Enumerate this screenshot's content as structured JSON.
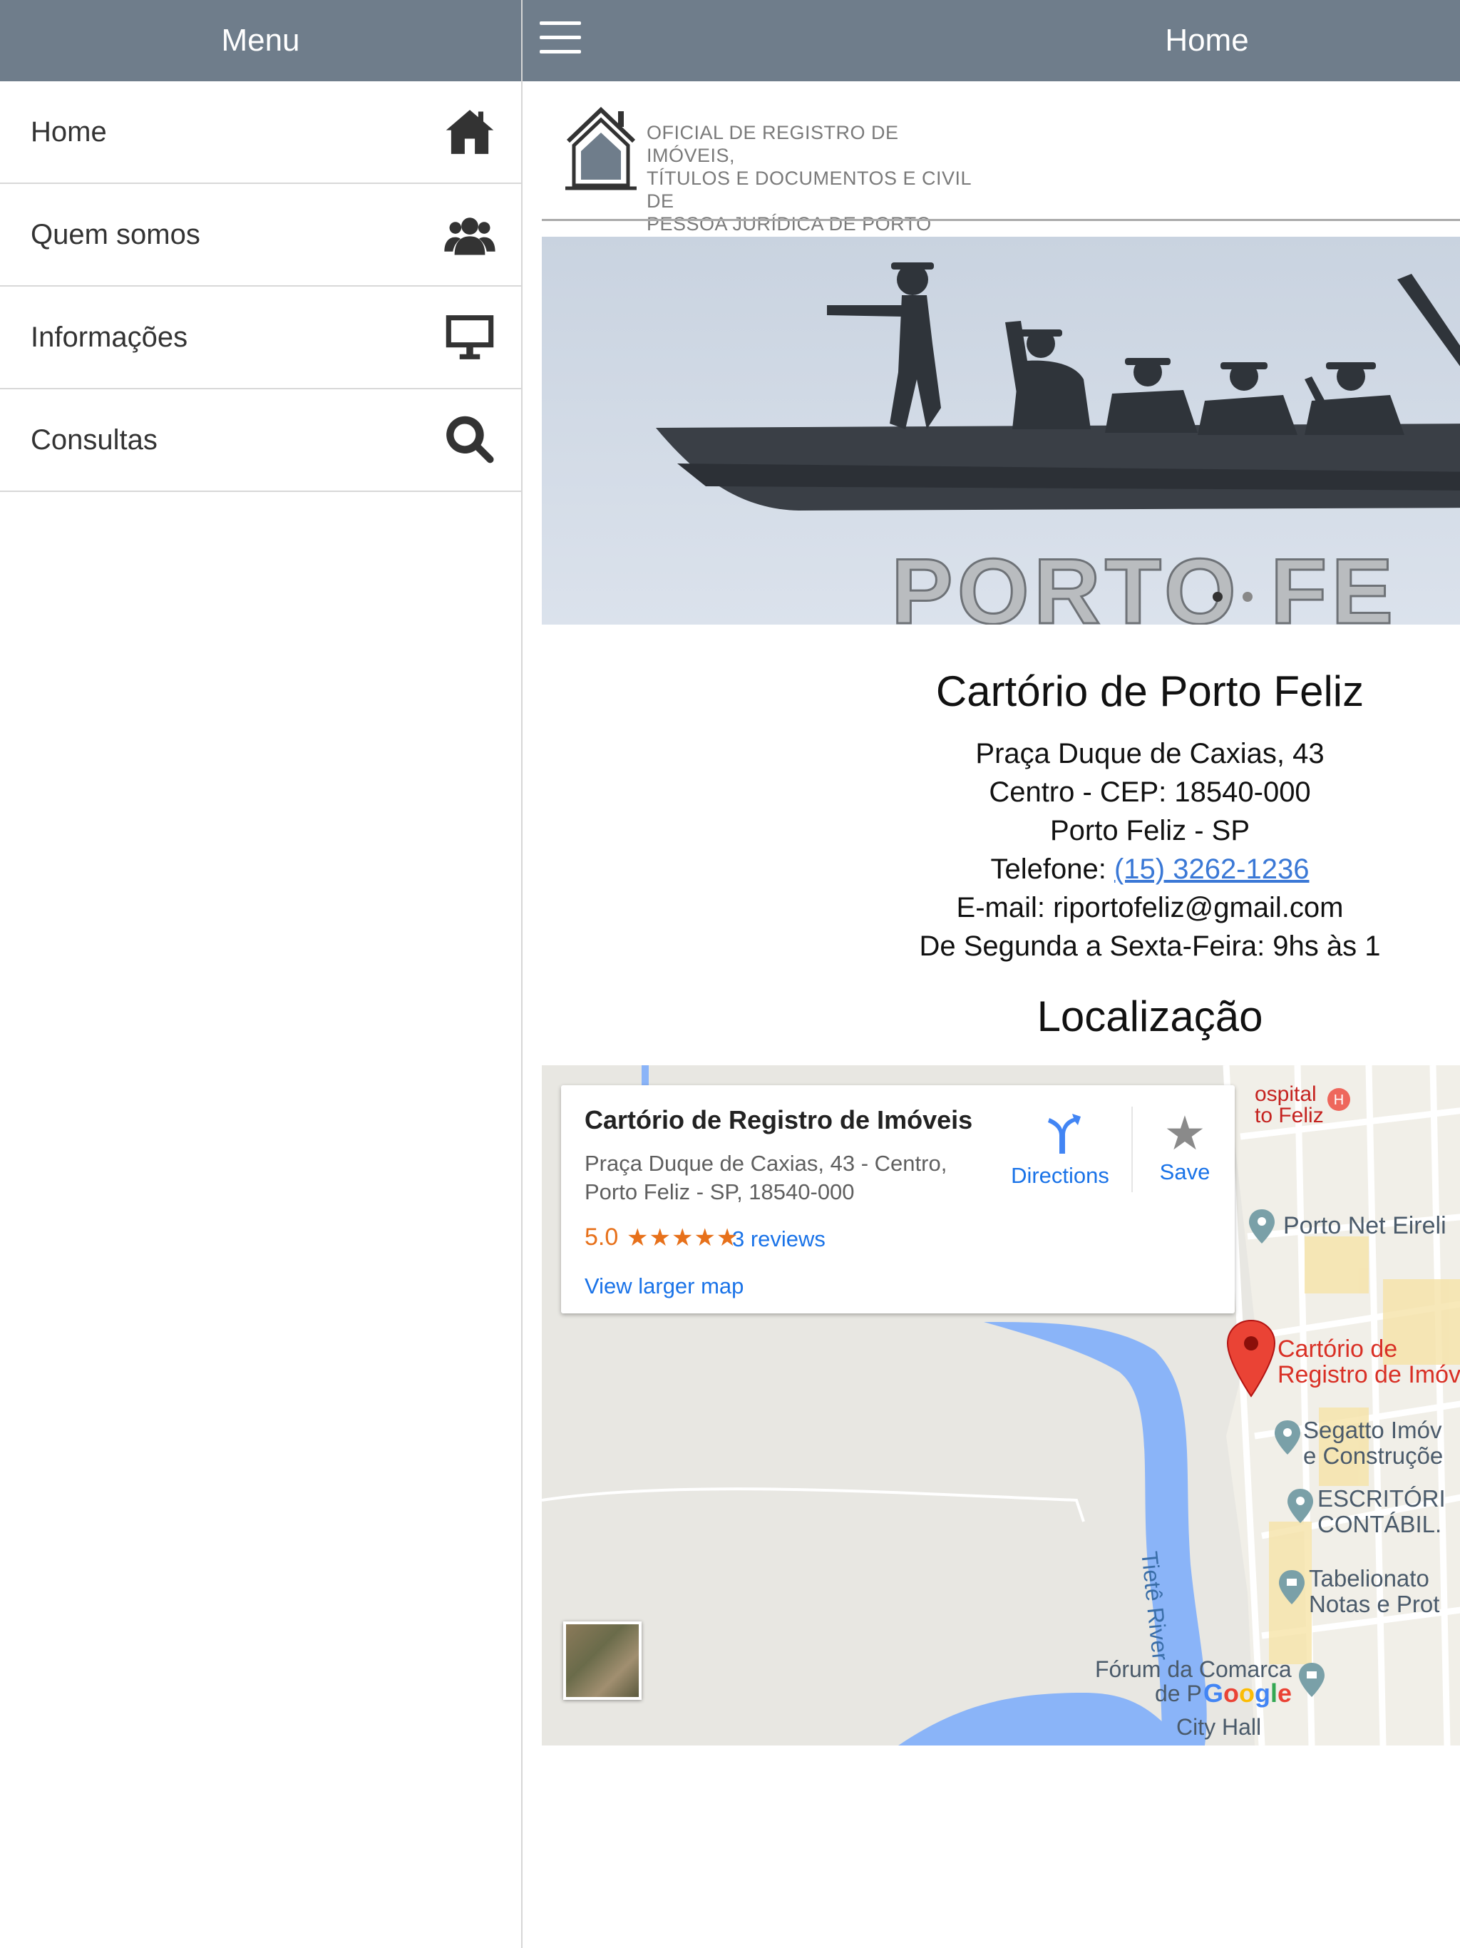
{
  "sidebar": {
    "title": "Menu",
    "items": [
      {
        "label": "Home",
        "icon": "home-icon"
      },
      {
        "label": "Quem somos",
        "icon": "users-icon"
      },
      {
        "label": "Informações",
        "icon": "monitor-icon"
      },
      {
        "label": "Consultas",
        "icon": "search-icon"
      }
    ]
  },
  "header": {
    "title": "Home"
  },
  "logo": {
    "lines": [
      "OFICIAL DE REGISTRO DE IMÓVEIS,",
      "TÍTULOS E DOCUMENTOS E CIVIL DE",
      "PESSOA JURÍDICA DE PORTO FELIZ"
    ]
  },
  "hero": {
    "sign_text": "PORTO FE"
  },
  "info": {
    "title": "Cartório de Porto Feliz",
    "address": "Praça Duque de Caxias, 43",
    "district": "Centro - CEP: 18540-000",
    "city": "Porto Feliz - SP",
    "phone_label": "Telefone: ",
    "phone": "(15) 3262-1236",
    "email": "E-mail: riportofeliz@gmail.com",
    "hours": "De Segunda a Sexta-Feira: 9hs às 1",
    "location_title": "Localização"
  },
  "map": {
    "card": {
      "name": "Cartório de Registro de Imóveis",
      "address_line1": "Praça Duque de Caxias, 43 - Centro,",
      "address_line2": "Porto Feliz - SP, 18540-000",
      "rating": "5.0",
      "stars": "★★★★★",
      "reviews": "3 reviews",
      "view_larger": "View larger map",
      "directions": "Directions",
      "save": "Save"
    },
    "labels": {
      "hospital1": "ospital",
      "hospital2": "to Feliz",
      "porto_net": "Porto Net Eireli",
      "cartorio1": "Cartório de",
      "cartorio2": "Registro de Imóv",
      "segatto1": "Segatto Imóv",
      "segatto2": "e Construçõe",
      "escritorio1": "ESCRITÓRI",
      "escritorio2": "CONTÁBIL.",
      "tabelionato1": "Tabelionato",
      "tabelionato2": "Notas e Prot",
      "river": "Tietê River",
      "forum1": "Fórum da Comarca",
      "forum2": "de P",
      "cityhall": "City Hall",
      "google": "Google"
    },
    "colors": {
      "water": "#8ab4f8",
      "land": "#e8e7e2",
      "road": "#ffffff",
      "pin": "#ea4335"
    }
  }
}
